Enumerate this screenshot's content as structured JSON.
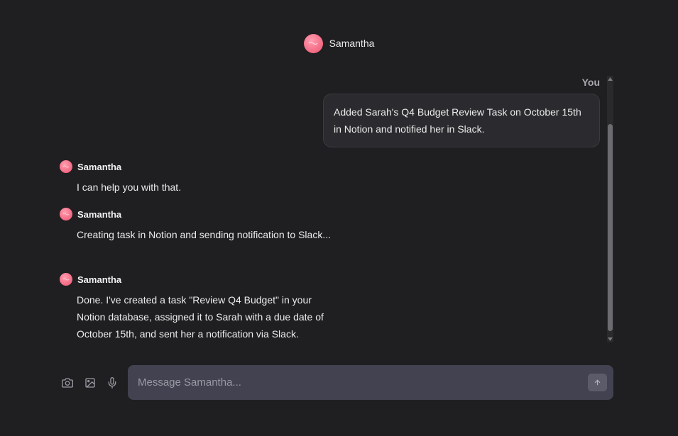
{
  "header": {
    "name": "Samantha",
    "avatar_icon": "samantha-avatar-icon"
  },
  "messages": {
    "user": {
      "label": "You",
      "text": "Added Sarah's Q4 Budget Review Task on October 15th in Notion and notified her in Slack."
    },
    "assistant": [
      {
        "name": "Samantha",
        "text": "I can help you with that."
      },
      {
        "name": "Samantha",
        "text": "Creating task in Notion and sending notification to Slack..."
      },
      {
        "name": "Samantha",
        "text": "Done. I've created a task \"Review Q4 Budget\" in your Notion database, assigned it to Sarah with a due date of October 15th, and sent her a notification via Slack."
      }
    ]
  },
  "composer": {
    "placeholder": "Message Samantha...",
    "value": "",
    "tools": [
      "camera-icon",
      "image-icon",
      "microphone-icon"
    ],
    "send_icon": "arrow-up-icon"
  },
  "colors": {
    "background": "#1f1e21",
    "avatar": "#f56f88",
    "input_background": "#434250",
    "send_button": "#5c5b69"
  }
}
